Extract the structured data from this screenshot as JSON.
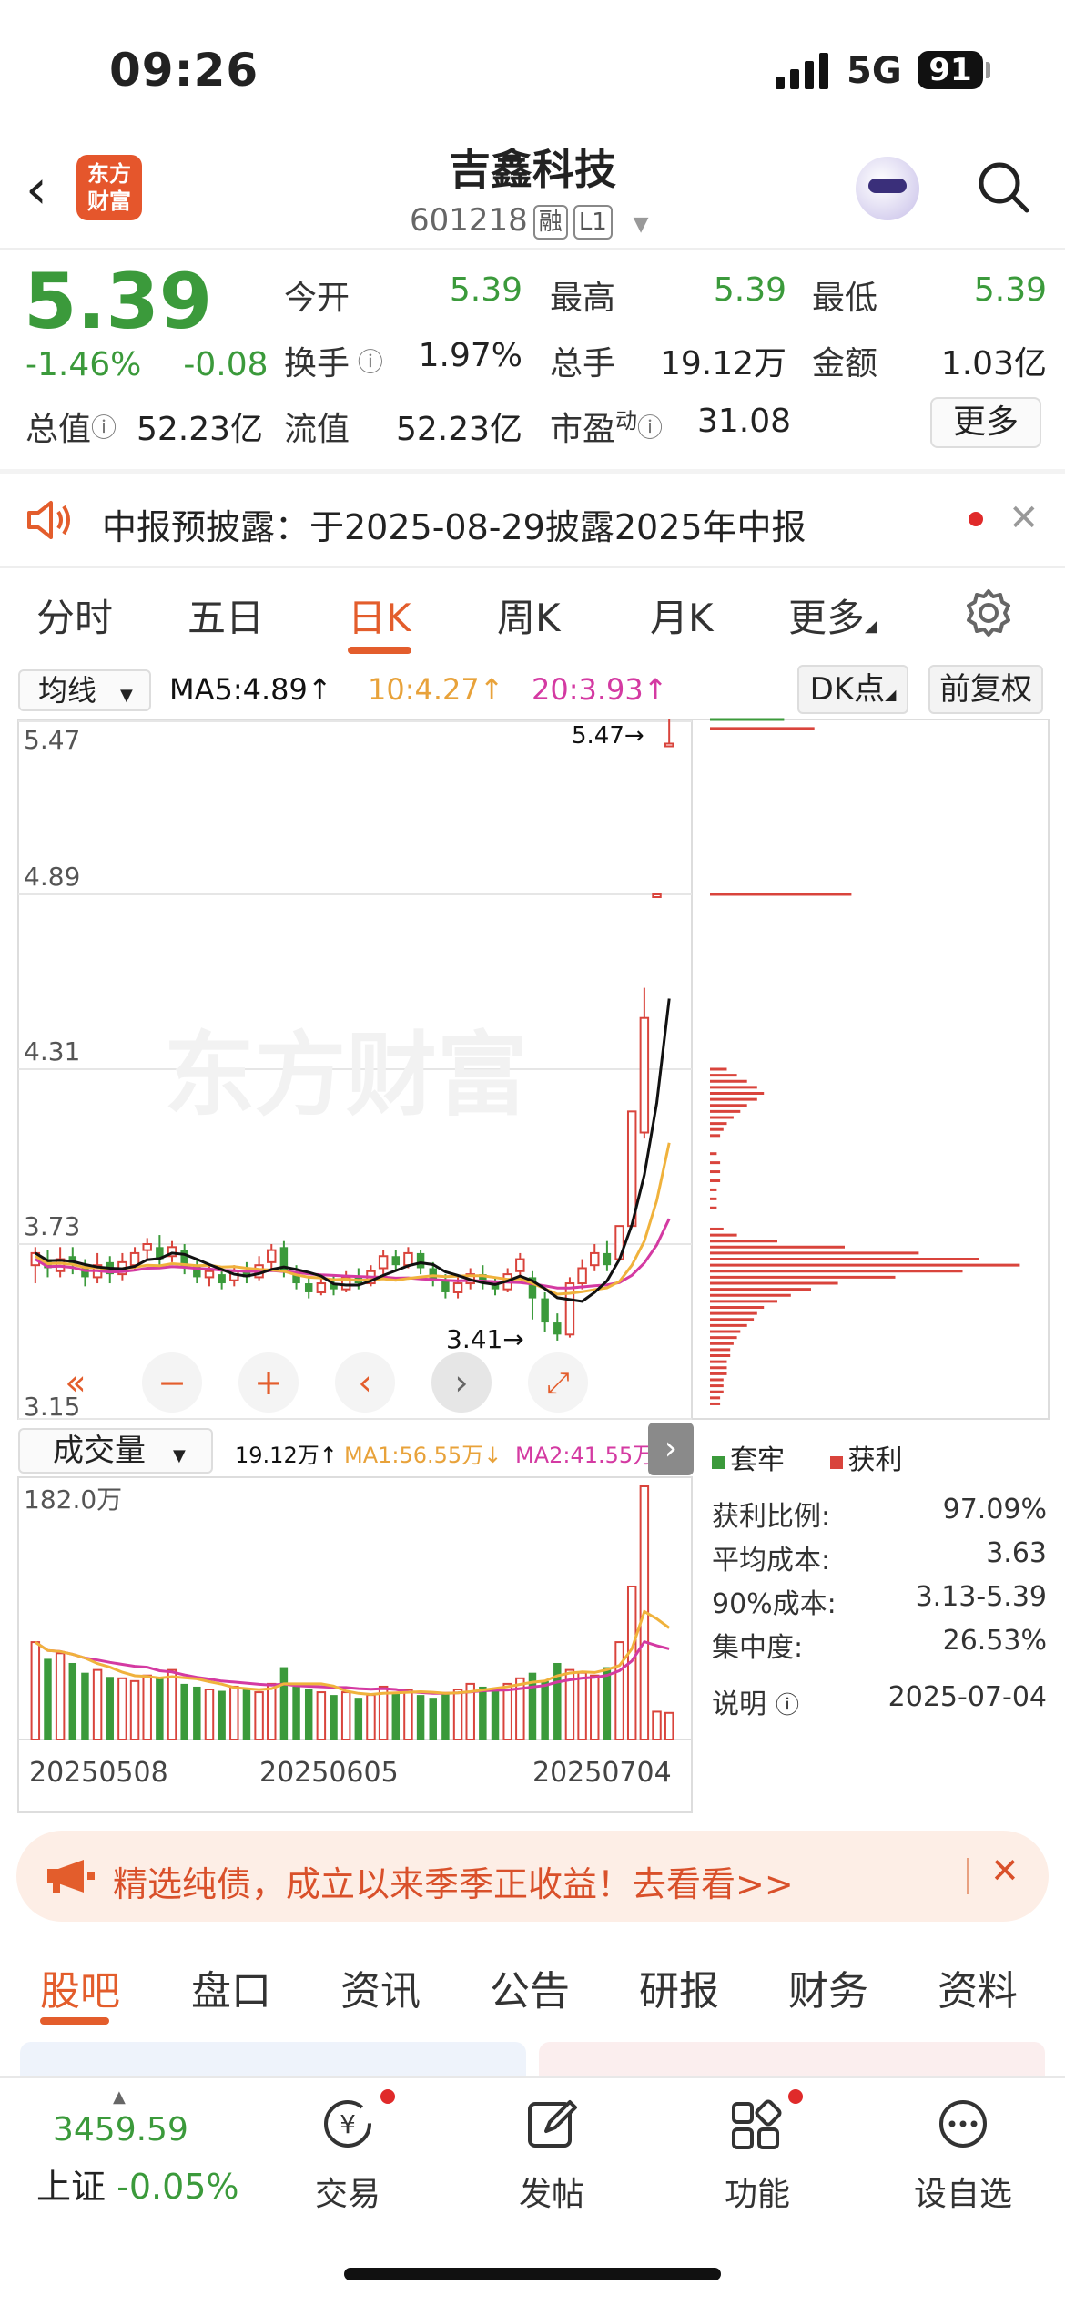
{
  "status": {
    "time": "09:26",
    "network": "5G",
    "battery": "91"
  },
  "header": {
    "logo_line1": "东方",
    "logo_line2": "财富",
    "name": "吉鑫科技",
    "code": "601218",
    "tag_margin": "融",
    "tag_level": "L1"
  },
  "quote": {
    "price": "5.39",
    "change_pct": "-1.46%",
    "change": "-0.08",
    "labels": {
      "open": "今开",
      "high": "最高",
      "low": "最低",
      "turnover": "换手",
      "volume": "总手",
      "amount": "金额",
      "mktcap": "总值",
      "float": "流值",
      "pe": "市盈",
      "pe_sup": "动"
    },
    "values": {
      "open": "5.39",
      "high": "5.39",
      "low": "5.39",
      "turnover": "1.97%",
      "volume": "19.12万",
      "amount": "1.03亿",
      "mktcap": "52.23亿",
      "float": "52.23亿",
      "pe": "31.08"
    },
    "more": "更多"
  },
  "notice": {
    "text": "中报预披露：于2025-08-29披露2025年中报"
  },
  "ktabs": [
    "分时",
    "五日",
    "日K",
    "周K",
    "月K",
    "更多"
  ],
  "indicators": {
    "ma_select": "均线",
    "ma5": "MA5:4.89",
    "ma10": "10:4.27",
    "ma20": "20:3.93",
    "dk": "DK点",
    "fq": "前复权",
    "vol_select": "成交量",
    "vol": "19.12万",
    "vol_ma1": "MA1:56.55万",
    "vol_ma2": "MA2:41.55万"
  },
  "colors": {
    "up": "#d9443c",
    "down": "#3b9a3b",
    "ma5": "#111111",
    "ma10": "#f0b23c",
    "ma20": "#d43aa2",
    "accent": "#e35d2c"
  },
  "chart_data": {
    "type": "candlestick",
    "y_ticks": [
      "5.47",
      "4.89",
      "4.31",
      "3.73",
      "3.15"
    ],
    "ylim": [
      3.15,
      5.47
    ],
    "annotations": {
      "high": "5.47→",
      "low": "3.41→"
    },
    "x_ticks": [
      "20250508",
      "20250605",
      "20250704"
    ],
    "volume_ymax_label": "182.0万",
    "candles": [
      [
        3.66,
        3.7,
        3.6,
        3.72
      ],
      [
        3.68,
        3.65,
        3.62,
        3.71
      ],
      [
        3.64,
        3.68,
        3.62,
        3.72
      ],
      [
        3.69,
        3.66,
        3.63,
        3.72
      ],
      [
        3.65,
        3.62,
        3.59,
        3.68
      ],
      [
        3.62,
        3.66,
        3.6,
        3.7
      ],
      [
        3.67,
        3.63,
        3.6,
        3.69
      ],
      [
        3.63,
        3.67,
        3.61,
        3.7
      ],
      [
        3.66,
        3.7,
        3.64,
        3.72
      ],
      [
        3.71,
        3.73,
        3.68,
        3.75
      ],
      [
        3.72,
        3.68,
        3.66,
        3.76
      ],
      [
        3.69,
        3.72,
        3.67,
        3.74
      ],
      [
        3.71,
        3.65,
        3.63,
        3.73
      ],
      [
        3.66,
        3.62,
        3.6,
        3.68
      ],
      [
        3.62,
        3.64,
        3.59,
        3.66
      ],
      [
        3.63,
        3.6,
        3.58,
        3.65
      ],
      [
        3.61,
        3.64,
        3.59,
        3.66
      ],
      [
        3.64,
        3.62,
        3.6,
        3.67
      ],
      [
        3.62,
        3.66,
        3.61,
        3.69
      ],
      [
        3.67,
        3.71,
        3.65,
        3.73
      ],
      [
        3.72,
        3.64,
        3.62,
        3.74
      ],
      [
        3.64,
        3.6,
        3.58,
        3.66
      ],
      [
        3.6,
        3.57,
        3.55,
        3.62
      ],
      [
        3.57,
        3.6,
        3.56,
        3.62
      ],
      [
        3.6,
        3.58,
        3.56,
        3.63
      ],
      [
        3.58,
        3.62,
        3.57,
        3.64
      ],
      [
        3.62,
        3.6,
        3.58,
        3.65
      ],
      [
        3.6,
        3.64,
        3.59,
        3.66
      ],
      [
        3.65,
        3.69,
        3.63,
        3.71
      ],
      [
        3.69,
        3.66,
        3.64,
        3.71
      ],
      [
        3.66,
        3.7,
        3.65,
        3.72
      ],
      [
        3.7,
        3.65,
        3.63,
        3.71
      ],
      [
        3.65,
        3.61,
        3.59,
        3.67
      ],
      [
        3.61,
        3.57,
        3.55,
        3.63
      ],
      [
        3.57,
        3.6,
        3.55,
        3.62
      ],
      [
        3.6,
        3.63,
        3.58,
        3.65
      ],
      [
        3.63,
        3.6,
        3.58,
        3.66
      ],
      [
        3.6,
        3.58,
        3.56,
        3.62
      ],
      [
        3.58,
        3.63,
        3.57,
        3.65
      ],
      [
        3.64,
        3.68,
        3.62,
        3.7
      ],
      [
        3.62,
        3.55,
        3.48,
        3.64
      ],
      [
        3.55,
        3.47,
        3.44,
        3.57
      ],
      [
        3.47,
        3.43,
        3.41,
        3.5
      ],
      [
        3.43,
        3.6,
        3.42,
        3.62
      ],
      [
        3.6,
        3.65,
        3.58,
        3.68
      ],
      [
        3.66,
        3.7,
        3.64,
        3.73
      ],
      [
        3.7,
        3.66,
        3.64,
        3.74
      ],
      [
        3.68,
        3.79,
        3.68,
        3.79
      ],
      [
        3.79,
        4.17,
        3.79,
        4.17
      ],
      [
        4.1,
        4.48,
        4.08,
        4.58
      ],
      [
        4.89,
        4.89,
        4.89,
        4.89
      ],
      [
        5.39,
        5.39,
        5.39,
        5.47
      ]
    ],
    "volumes": [
      70,
      58,
      62,
      55,
      48,
      50,
      45,
      44,
      42,
      46,
      44,
      50,
      40,
      38,
      36,
      35,
      38,
      36,
      34,
      40,
      52,
      38,
      36,
      34,
      32,
      34,
      30,
      32,
      38,
      34,
      36,
      32,
      30,
      34,
      36,
      40,
      38,
      36,
      40,
      44,
      48,
      42,
      55,
      50,
      48,
      46,
      52,
      70,
      110,
      182,
      20,
      19.12
    ],
    "chips": {
      "legend_trap": "套牢",
      "legend_profit": "获利",
      "profit_ratio_label": "获利比例:",
      "profit_ratio": "97.09%",
      "avg_cost_label": "平均成本:",
      "avg_cost": "3.63",
      "cost90_label": "90%成本:",
      "cost90": "3.13-5.39",
      "concentration_label": "集中度:",
      "concentration": "26.53%",
      "note_label": "说明",
      "date": "2025-07-04"
    }
  },
  "banner": {
    "text": "精选纯债，成立以来季季正收益！去看看>>"
  },
  "btabs": [
    "股吧",
    "盘口",
    "资讯",
    "公告",
    "研报",
    "财务",
    "资料"
  ],
  "nav": {
    "index_value": "3459.59",
    "index_name": "上证",
    "index_change": "-0.05%",
    "trade": "交易",
    "post": "发帖",
    "func": "功能",
    "watch": "设自选"
  }
}
